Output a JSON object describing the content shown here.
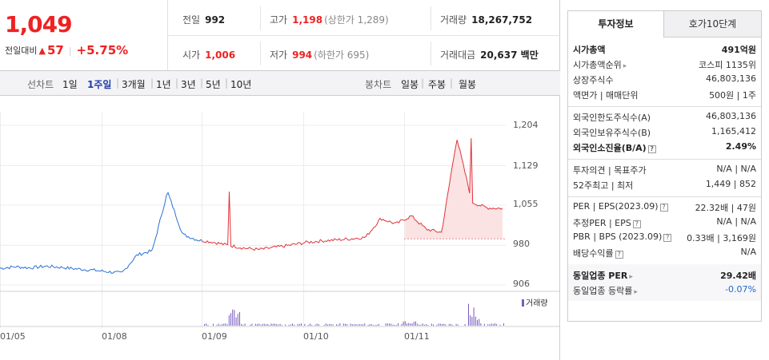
{
  "price": {
    "current": "1,049",
    "change_label": "전일대비",
    "change_arrow": "▲",
    "change_value": "57",
    "change_pct": "+5.75%"
  },
  "stats": {
    "prev_label": "전일",
    "prev": "992",
    "high_label": "고가",
    "high": "1,198",
    "upper_limit": "(상한가 1,289)",
    "volume_label": "거래량",
    "volume": "18,267,752",
    "open_label": "시가",
    "open": "1,006",
    "low_label": "저가",
    "low": "994",
    "lower_limit": "(하한가 695)",
    "amount_label": "거래대금",
    "amount": "20,637 백만"
  },
  "line_tabs": {
    "label": "선차트",
    "items": [
      "1일",
      "1주일",
      "3개월",
      "1년",
      "3년",
      "5년",
      "10년"
    ],
    "active": "1주일"
  },
  "candle_tabs": {
    "label": "봉차트",
    "items": [
      "일봉",
      "주봉",
      "월봉"
    ]
  },
  "chart": {
    "y_ticks": [
      "1,204",
      "1,129",
      "1,055",
      "980",
      "906"
    ],
    "x_ticks": [
      "01/05",
      "01/08",
      "01/09",
      "01/10",
      "01/11"
    ],
    "volume_legend": "거래량",
    "colors": {
      "down": "#2a6fd6",
      "up": "#e0333a",
      "volume": "#7a5abf",
      "fill": "#fbe3e4"
    }
  },
  "chart_data": {
    "type": "line",
    "x": [
      "01/05",
      "01/08",
      "01/09",
      "01/10",
      "01/11"
    ],
    "ylim": [
      906,
      1204
    ],
    "y_ticks": [
      906,
      980,
      1055,
      1129,
      1204
    ],
    "series": [
      {
        "values": [
          937,
          940,
          938,
          941,
          939,
          936,
          934,
          931,
          928,
          962,
          970,
          1080,
          1000,
          990,
          986,
          980,
          975,
          972,
          976,
          980,
          985,
          988,
          990,
          992,
          995,
          1030,
          1020,
          1035,
          1010,
          1004,
          1180,
          1060,
          1050,
          1049
        ]
      }
    ],
    "reference_value": 992
  },
  "right": {
    "tabs": [
      "투자정보",
      "호가10단계"
    ],
    "rows1": [
      {
        "k": "시가총액",
        "v": "491억원",
        "bold": true
      },
      {
        "k": "시가총액순위",
        "v": "코스피 1135위",
        "arrow": true
      },
      {
        "k": "상장주식수",
        "v": "46,803,136"
      },
      {
        "k": "액면가 | 매매단위",
        "v": "500원 | 1주"
      }
    ],
    "rows2": [
      {
        "k": "외국인한도주식수(A)",
        "v": "46,803,136"
      },
      {
        "k": "외국인보유주식수(B)",
        "v": "1,165,412"
      },
      {
        "k": "외국인소진율(B/A)",
        "v": "2.49%",
        "bold": true,
        "q": true
      }
    ],
    "rows3": [
      {
        "k": "투자의견 | 목표주가",
        "v": "N/A | N/A"
      },
      {
        "k": "52주최고 | 최저",
        "v": "1,449 | 852"
      }
    ],
    "rows4": [
      {
        "k": "PER | EPS(2023.09)",
        "v": "22.32배 | 47원",
        "q": true
      },
      {
        "k": "추정PER | EPS",
        "v": "N/A | N/A",
        "q": true
      },
      {
        "k": "PBR | BPS (2023.09)",
        "v": "0.33배 | 3,169원",
        "q": true
      },
      {
        "k": "배당수익률",
        "v": "N/A",
        "q": true
      }
    ],
    "rows5": [
      {
        "k": "동일업종 PER",
        "v": "29.42배",
        "bold": true,
        "arrow": true
      },
      {
        "k": "동일업종 등락률",
        "v": "-0.07%",
        "arrow": true,
        "blue": true
      }
    ]
  }
}
